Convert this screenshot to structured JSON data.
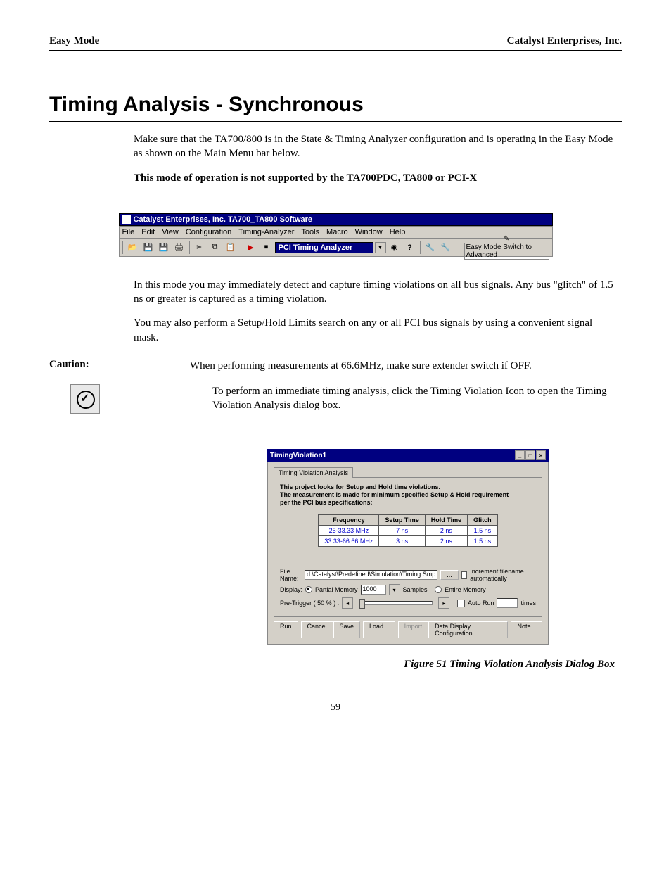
{
  "header": {
    "left": "Easy Mode",
    "right": "Catalyst Enterprises, Inc."
  },
  "title": "Timing Analysis - Synchronous",
  "intro": {
    "p1": "Make sure that the TA700/800 is in the State & Timing Analyzer configuration and is operating in the Easy Mode as shown on the Main Menu bar below.",
    "p2": "This mode of operation is not supported by the TA700PDC, TA800 or PCI-X"
  },
  "menubar_fig": {
    "titlebar": "Catalyst Enterprises, Inc. TA700_TA800 Software",
    "menus": [
      "File",
      "Edit",
      "View",
      "Configuration",
      "Timing-Analyzer",
      "Tools",
      "Macro",
      "Window",
      "Help"
    ],
    "combo": "PCI Timing Analyzer",
    "mode_label": "Easy Mode Switch to Advanced"
  },
  "mid": {
    "p1": "In this mode you may immediately detect and capture timing violations on all bus signals. Any bus \"glitch\" of 1.5 ns or greater is captured as a timing violation.",
    "p2": "You may also perform a Setup/Hold Limits search on any or all PCI bus signals by using a convenient signal mask."
  },
  "caution": {
    "label": "Caution:",
    "text": "When performing measurements at 66.6MHz, make sure extender switch if OFF."
  },
  "action": "To perform an immediate timing analysis, click the Timing Violation Icon to open the Timing Violation Analysis dialog box.",
  "dialog": {
    "title": "TimingViolation1",
    "tab": "Timing Violation Analysis",
    "desc1": "This project looks for Setup and Hold time violations.",
    "desc2": "The measurement is made for minimum specified Setup & Hold requirement",
    "desc3": "per the PCI bus specifications:",
    "table_headers": [
      "Frequency",
      "Setup Time",
      "Hold Time",
      "Glitch"
    ],
    "rows": [
      [
        "25-33.33 MHz",
        "7 ns",
        "2 ns",
        "1.5 ns"
      ],
      [
        "33.33-66.66 MHz",
        "3 ns",
        "2 ns",
        "1.5 ns"
      ]
    ],
    "filename_label": "File Name:",
    "filename_value": "d:\\Catalyst\\Predefined\\Simulation\\Timing.Smp",
    "increment_label": "Increment filename automatically",
    "display_label": "Display:",
    "partial_label": "Partial Memory",
    "partial_value": "1000",
    "samples_label": "Samples",
    "entire_label": "Entire Memory",
    "pretrigger_label": "Pre-Trigger ( 50 % ) :",
    "autorun_label": "Auto Run",
    "autorun_value": "",
    "times_label": "times",
    "buttons": {
      "run": "Run",
      "cancel": "Cancel",
      "save": "Save",
      "load": "Load...",
      "import": "Import",
      "ddc": "Data Display Configuration",
      "note": "Note..."
    }
  },
  "fig_caption": "Figure  51  Timing Violation Analysis Dialog Box",
  "page_number": "59",
  "chart_data": {
    "type": "table",
    "title": "PCI bus Setup & Hold requirement",
    "columns": [
      "Frequency",
      "Setup Time",
      "Hold Time",
      "Glitch"
    ],
    "rows": [
      {
        "Frequency": "25-33.33 MHz",
        "Setup Time": "7 ns",
        "Hold Time": "2 ns",
        "Glitch": "1.5 ns"
      },
      {
        "Frequency": "33.33-66.66 MHz",
        "Setup Time": "3 ns",
        "Hold Time": "2 ns",
        "Glitch": "1.5 ns"
      }
    ]
  }
}
